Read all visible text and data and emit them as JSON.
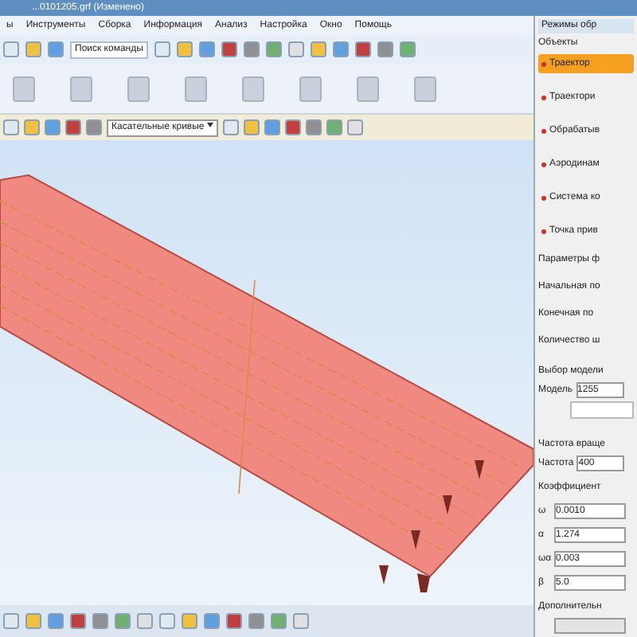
{
  "window": {
    "title": "...0101205.grf (Изменено)"
  },
  "menu": [
    "ы",
    "Инструменты",
    "Сборка",
    "Информация",
    "Анализ",
    "Настройка",
    "Окно",
    "Помощь"
  ],
  "toolbar": {
    "search_label": "Поиск команды",
    "curve_dropdown": "Касательные кривые"
  },
  "panel": {
    "title": "Режимы обр",
    "objects_label": "Объекты",
    "objects": [
      {
        "label": "Траектор",
        "selected": true
      },
      {
        "label": "Траектори",
        "selected": false
      },
      {
        "label": "Обрабатыв",
        "selected": false
      },
      {
        "label": "Аэродинам",
        "selected": false
      },
      {
        "label": "Система ко",
        "selected": false
      },
      {
        "label": "Точка прив",
        "selected": false
      }
    ],
    "params_label": "Параметры ф",
    "params": [
      "Начальная по",
      "Конечная по",
      "Количество ш"
    ],
    "model_label": "Выбор модели",
    "model": {
      "label": "Модель",
      "value": "1255"
    },
    "freq_label": "Частота враще",
    "freq": {
      "label": "Частота",
      "value": "400"
    },
    "coef_label": "Коэффициент",
    "coefs": [
      {
        "symbol": "ω",
        "value": "0.0010"
      },
      {
        "symbol": "α",
        "value": "1.274"
      },
      {
        "symbol": "ωα",
        "value": "0.003"
      },
      {
        "symbol": "β",
        "value": "5.0"
      }
    ],
    "extra_label": "Дополнительн"
  }
}
